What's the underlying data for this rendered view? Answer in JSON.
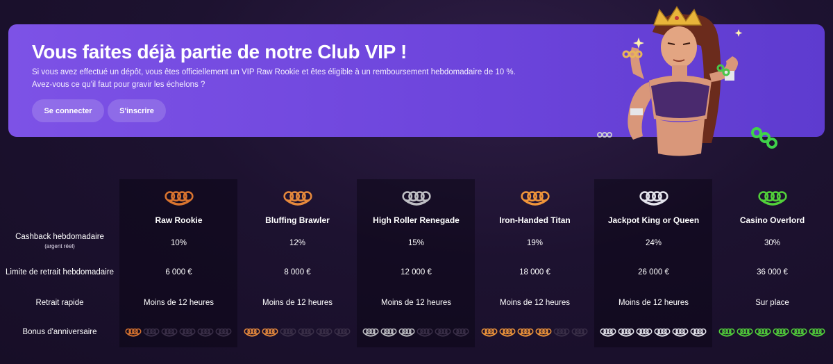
{
  "banner": {
    "title": "Vous faites déjà partie de notre Club VIP !",
    "line1": "Si vous avez effectué un dépôt, vous êtes officiellement un VIP Raw Rookie et êtes éligible à un remboursement hebdomadaire de 10 %.",
    "line2": "Avez-vous ce qu'il faut pour gravir les échelons ?",
    "login_label": "Se connecter",
    "register_label": "S'inscrire"
  },
  "rows": {
    "cashback": "Cashback hebdomadaire",
    "cashback_sub": "(argent réel)",
    "withdrawal_limit": "Limite de retrait hebdomadaire",
    "fast_withdrawal": "Retrait rapide",
    "birthday_bonus": "Bonus d'anniversaire"
  },
  "tiers": [
    {
      "name": "Raw Rookie",
      "cashback": "10%",
      "limit": "6 000 €",
      "speed": "Moins de 12 heures",
      "color": "#d9742f",
      "bonus_level": 1
    },
    {
      "name": "Bluffing Brawler",
      "cashback": "12%",
      "limit": "8 000 €",
      "speed": "Moins de 12 heures",
      "color": "#e6893c",
      "bonus_level": 2
    },
    {
      "name": "High Roller Renegade",
      "cashback": "15%",
      "limit": "12 000 €",
      "speed": "Moins de 12 heures",
      "color": "#bfbfc4",
      "bonus_level": 3
    },
    {
      "name": "Iron-Handed Titan",
      "cashback": "19%",
      "limit": "18 000 €",
      "speed": "Moins de 12 heures",
      "color": "#f0953a",
      "bonus_level": 4
    },
    {
      "name": "Jackpot King or Queen",
      "cashback": "24%",
      "limit": "26 000 €",
      "speed": "Moins de 12 heures",
      "color": "#e4e4ec",
      "bonus_level": 6
    },
    {
      "name": "Casino Overlord",
      "cashback": "30%",
      "limit": "36 000 €",
      "speed": "Sur place",
      "color": "#52d13a",
      "bonus_level": 6
    }
  ],
  "bonus_slots": 6,
  "colors": {
    "banner": "#7a50e4",
    "background": "#1d1230",
    "dim_icon": "#3a2f48"
  }
}
